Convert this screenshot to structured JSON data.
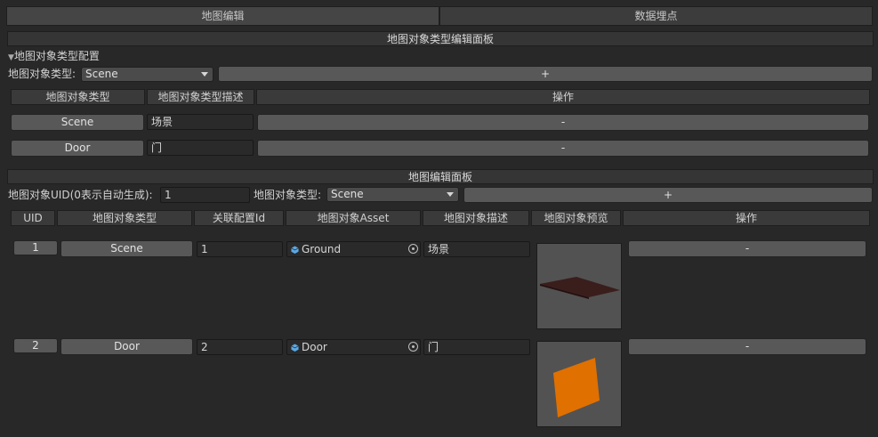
{
  "tabs": [
    {
      "label": "地图编辑"
    },
    {
      "label": "数据埋点"
    }
  ],
  "type_panel": {
    "title": "地图对象类型编辑面板",
    "foldout_label": "地图对象类型配置",
    "type_label": "地图对象类型:",
    "type_value": "Scene",
    "add_label": "+",
    "columns": [
      "地图对象类型",
      "地图对象类型描述",
      "操作"
    ],
    "rows": [
      {
        "type": "Scene",
        "desc": "场景",
        "remove": "-"
      },
      {
        "type": "Door",
        "desc": "门",
        "remove": "-"
      }
    ]
  },
  "edit_panel": {
    "title": "地图编辑面板",
    "uid_label": "地图对象UID(0表示自动生成):",
    "uid_value": "1",
    "type_label": "地图对象类型:",
    "type_value": "Scene",
    "add_label": "+",
    "columns": [
      "UID",
      "地图对象类型",
      "关联配置Id",
      "地图对象Asset",
      "地图对象描述",
      "地图对象预览",
      "操作"
    ],
    "rows": [
      {
        "uid": "1",
        "type": "Scene",
        "config_id": "1",
        "asset": "Ground",
        "desc": "场景",
        "remove": "-",
        "preview_icon": "flat-ground-plane"
      },
      {
        "uid": "2",
        "type": "Door",
        "config_id": "2",
        "asset": "Door",
        "desc": "门",
        "remove": "-",
        "preview_icon": "orange-door-panel"
      }
    ]
  },
  "colors": {
    "background": "#282828",
    "button": "#585858",
    "prefab_icon": "#5aa9e6",
    "door_orange": "#e07000"
  }
}
